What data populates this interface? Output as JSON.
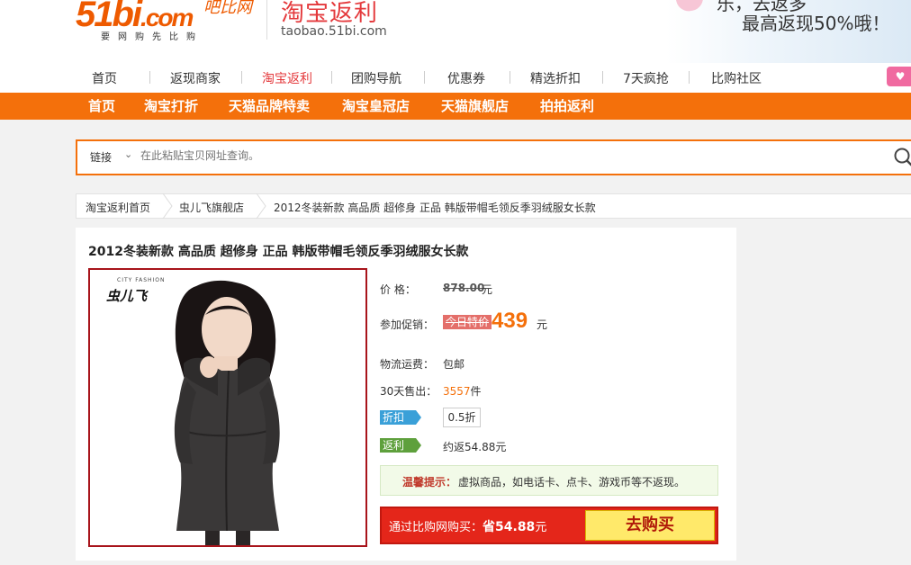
{
  "header": {
    "logo_main": "51bi",
    "logo_dotcom": ".com",
    "logo_script": "吧比网",
    "logo_slogan": "要网购先比购",
    "site_title": "淘宝返利",
    "site_domain": "taobao.51bi.com",
    "promo_line1": "乐，去返多",
    "promo_line2": "最高返现50%哦！"
  },
  "nav1": {
    "items": [
      "首页",
      "返现商家",
      "淘宝返利",
      "团购导航",
      "优惠券",
      "精选折扣",
      "7天疯抢",
      "比购社区"
    ],
    "active_index": 2
  },
  "nav2": {
    "items": [
      "首页",
      "淘宝打折",
      "天猫品牌特卖",
      "淘宝皇冠店",
      "天猫旗舰店",
      "拍拍返利"
    ]
  },
  "search": {
    "type_label": "链接",
    "placeholder": "在此粘贴宝贝网址查询。"
  },
  "breadcrumb": [
    "淘宝返利首页",
    "虫儿飞旗舰店",
    "2012冬装新款 高品质 超修身 正品 韩版带帽毛领反季羽绒服女长款"
  ],
  "product": {
    "title": "2012冬装新款 高品质 超修身 正品 韩版带帽毛领反季羽绒服女长款",
    "brand_mark": "虫儿飞",
    "brand_sub": "CITY FASHION",
    "price_label": "价    格：",
    "original_price": "878.00",
    "currency_unit": "元",
    "promo_label": "参加促销：",
    "promo_tag": "今日特价",
    "sale_price": "439",
    "shipping_label": "物流运费：",
    "shipping_value": "包邮",
    "sold_label": "30天售出：",
    "sold_count": "3557",
    "sold_unit": "件",
    "discount_tag": "折扣",
    "discount_value": "0.5折",
    "rebate_tag": "返利",
    "rebate_value": "约返54.88元"
  },
  "tip": {
    "label": "温馨提示：",
    "text": "虚拟商品，如电话卡、点卡、游戏币等不返现。"
  },
  "buybar": {
    "prefix": "通过比购网购买：",
    "save_text": "省54.88",
    "unit": "元",
    "button_label": "去购买"
  },
  "colors": {
    "brand_orange": "#f4700b",
    "price_orange": "#f4700b",
    "buy_red": "#e4261a",
    "buy_button": "#ffe96a"
  }
}
